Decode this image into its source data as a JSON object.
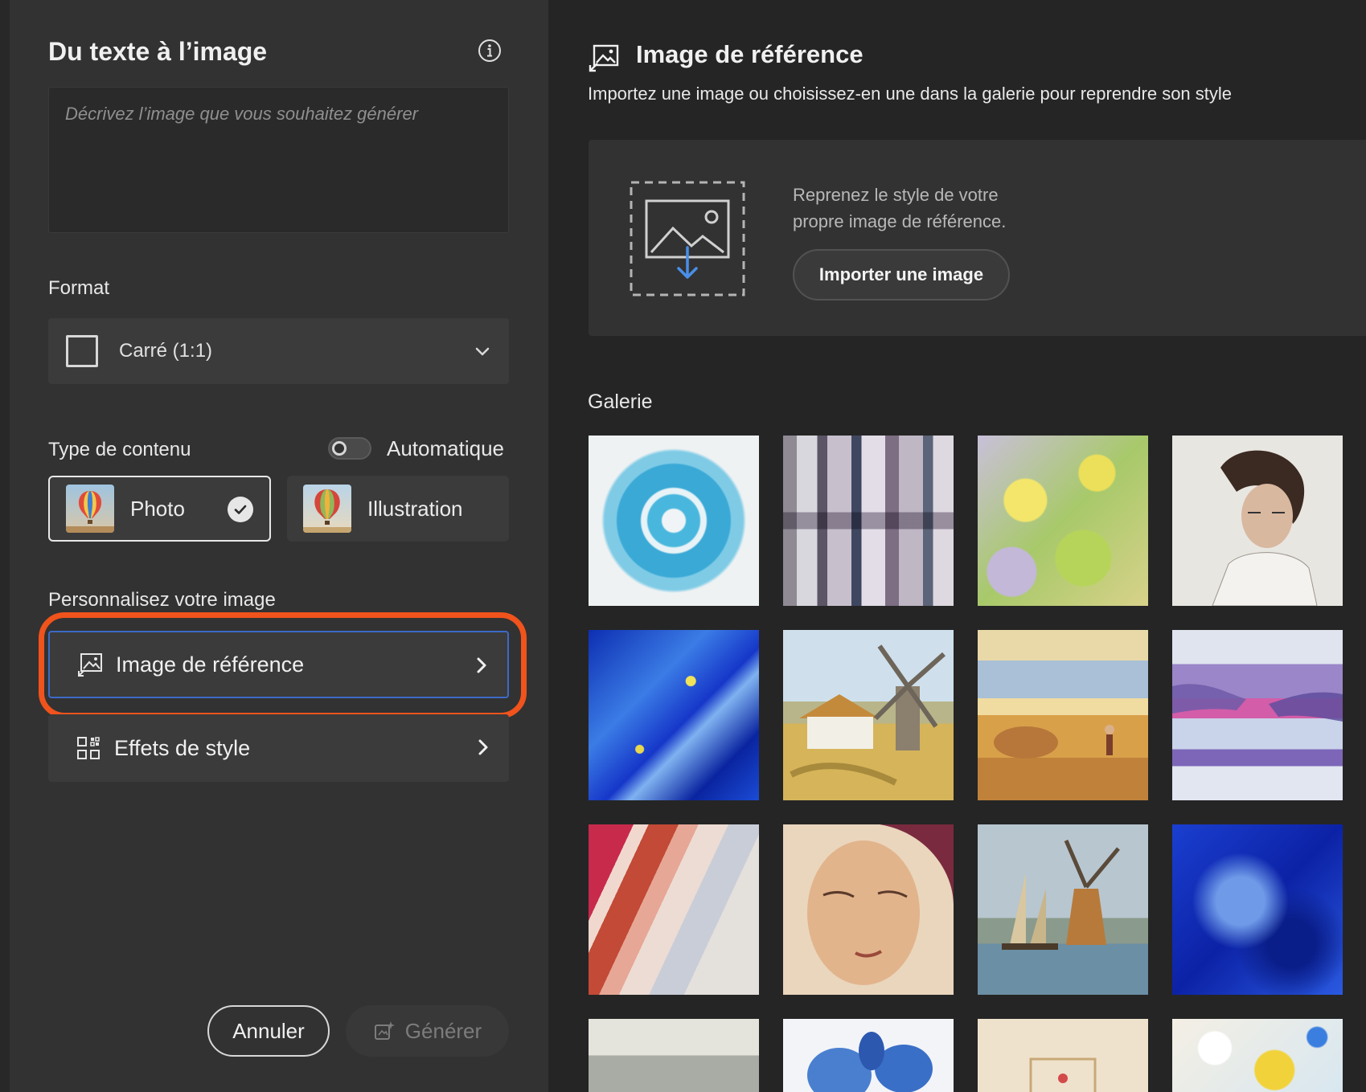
{
  "left_panel": {
    "title": "Du texte à l’image",
    "prompt_placeholder": "Décrivez l’image que vous souhaitez générer",
    "format_label": "Format",
    "format_value": "Carré (1:1)",
    "content_type_label": "Type de contenu",
    "auto_label": "Automatique",
    "auto_toggle_on": false,
    "content_types": [
      {
        "label": "Photo",
        "selected": true
      },
      {
        "label": "Illustration",
        "selected": false
      }
    ],
    "customize_label": "Personnalisez votre image",
    "nav_items": [
      {
        "label": "Image de référence",
        "active": true
      },
      {
        "label": "Effets de style",
        "active": false
      }
    ],
    "cancel_label": "Annuler",
    "generate_label": "Générer",
    "highlight_color": "#f0531c",
    "active_border_color": "#3c6ac7"
  },
  "right_panel": {
    "title": "Image de référence",
    "subtitle": "Importez une image ou choisissez-en une dans la galerie pour reprendre son style",
    "upload_description": "Reprenez le style de votre propre image de référence.",
    "import_button_label": "Importer une image",
    "gallery_label": "Galerie",
    "gallery_tiles": [
      "blue-swirl",
      "abstract-gray-smears",
      "yellow-green-impasto",
      "woman-portrait-sketch",
      "blue-marble-gold",
      "windmill-cottage",
      "wheat-field-harvest",
      "hands-watercolor",
      "red-cream-waves",
      "woman-face-painting",
      "windmill-sailboats",
      "blue-ink-cloud",
      "city-skyline",
      "blue-flowers",
      "framed-picture",
      "flower-splash"
    ]
  },
  "icons": [
    "info-icon",
    "chevron-down-icon",
    "check-icon",
    "chevron-right-icon",
    "image-reference-icon",
    "style-effects-icon",
    "generate-icon",
    "image-upload-icon"
  ]
}
